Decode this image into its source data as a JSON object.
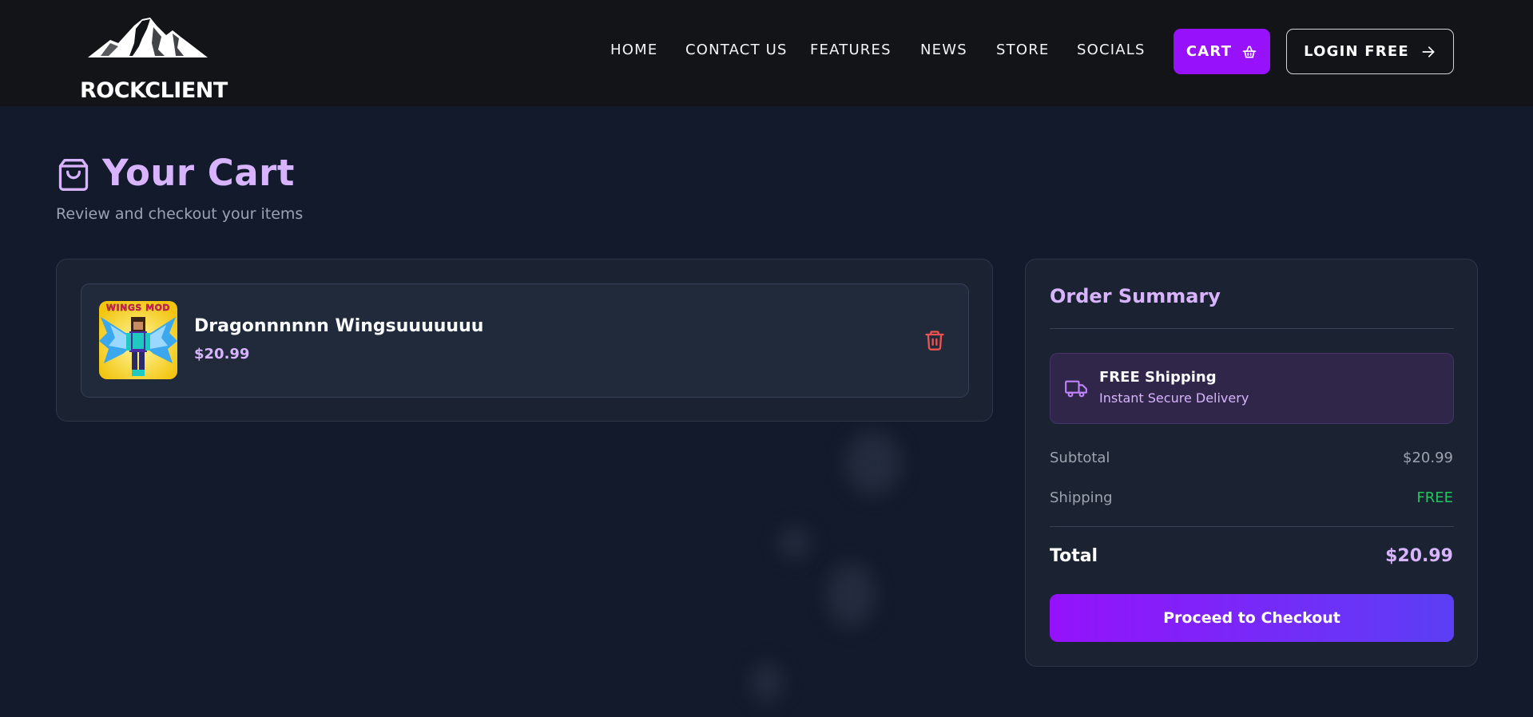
{
  "brand": {
    "name": "ROCKCLIENT"
  },
  "nav": {
    "links": [
      "HOME",
      "CONTACT US",
      "FEATURES",
      "NEWS",
      "STORE",
      "SOCIALS"
    ],
    "cart_label": "CART",
    "login_label": "LOGIN FREE"
  },
  "page": {
    "title": "Your Cart",
    "subtitle": "Review and checkout your items"
  },
  "cart": {
    "items": [
      {
        "name": "Dragonnnnnn Wingsuuuuuuu",
        "price": "$20.99",
        "thumb_caption": "WINGS MOD"
      }
    ]
  },
  "summary": {
    "title": "Order Summary",
    "shipping_title": "FREE Shipping",
    "shipping_subtitle": "Instant Secure Delivery",
    "subtotal_label": "Subtotal",
    "subtotal_value": "$20.99",
    "shipping_label": "Shipping",
    "shipping_value": "FREE",
    "total_label": "Total",
    "total_value": "$20.99",
    "checkout_label": "Proceed to Checkout"
  },
  "colors": {
    "accent": "#9711fb",
    "accent_light": "#d8b4fe",
    "free_green": "#22c55e",
    "trash_red": "#ef5350"
  },
  "icons": {
    "logo": "mountain-icon",
    "cart": "basket-icon",
    "login": "arrow-right-icon",
    "title": "shopping-bag-icon",
    "remove": "trash-icon",
    "shipping": "truck-icon"
  }
}
